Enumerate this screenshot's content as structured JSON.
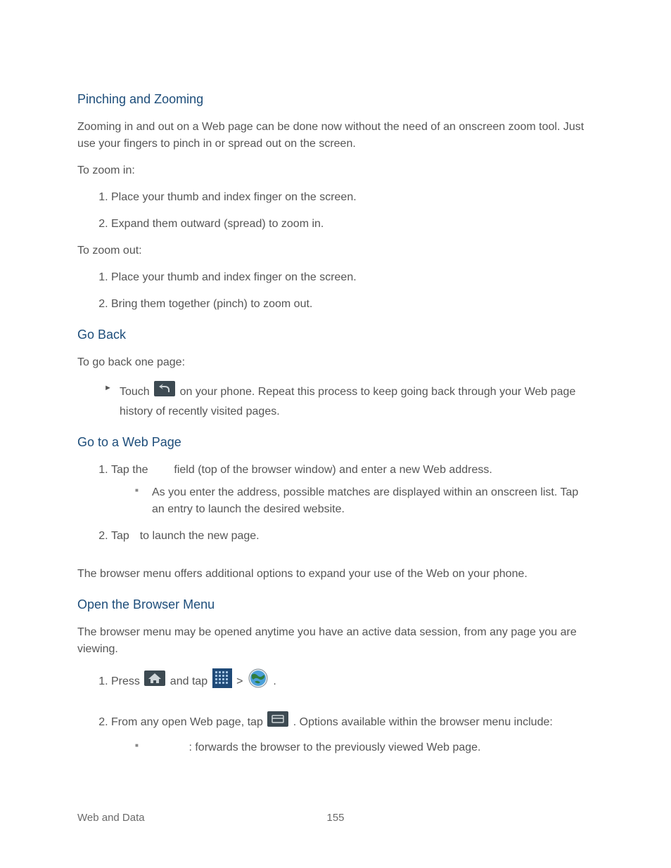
{
  "sections": {
    "pinch": {
      "heading": "Pinching and Zooming",
      "intro": "Zooming in and out on a Web page can be done now without the need of an onscreen zoom tool. Just use your fingers to pinch in or spread out on the screen.",
      "zoomInLabel": "To zoom in:",
      "zoomInSteps": [
        "Place your thumb and index finger on the screen.",
        "Expand them outward (spread) to zoom in."
      ],
      "zoomOutLabel": "To zoom out:",
      "zoomOutSteps": [
        "Place your thumb and index finger on the screen.",
        "Bring them together (pinch) to zoom out."
      ]
    },
    "goBack": {
      "heading": "Go Back",
      "intro": "To go back one page:",
      "touchLabel": "Touch ",
      "afterIcon": " on your phone. Repeat this process to keep going back through your Web page history of recently visited pages."
    },
    "goToPage": {
      "heading": "Go to a Web Page",
      "step1_a": "Tap the ",
      "step1_b": " field (top of the browser window) and enter a new Web address.",
      "sub1": "As you enter the address, possible matches are displayed within an onscreen list. Tap an entry to launch the desired website.",
      "step2_a": "Tap ",
      "step2_b": " to launch the new page."
    },
    "browserMenuIntro": "The browser menu offers additional options to expand your use of the Web on your phone.",
    "openMenu": {
      "heading": "Open the Browser Menu",
      "intro": "The browser menu may be opened anytime you have an active data session, from any page you are viewing.",
      "step1_a": "Press ",
      "step1_b": " and tap ",
      "step1_c": " > ",
      "step1_d": ".",
      "step2_a": "From any open Web page, tap ",
      "step2_b": ". Options available within the browser menu include:",
      "option1": ": forwards the browser to the previously viewed Web page."
    }
  },
  "footer": {
    "section": "Web and Data",
    "page": "155"
  }
}
